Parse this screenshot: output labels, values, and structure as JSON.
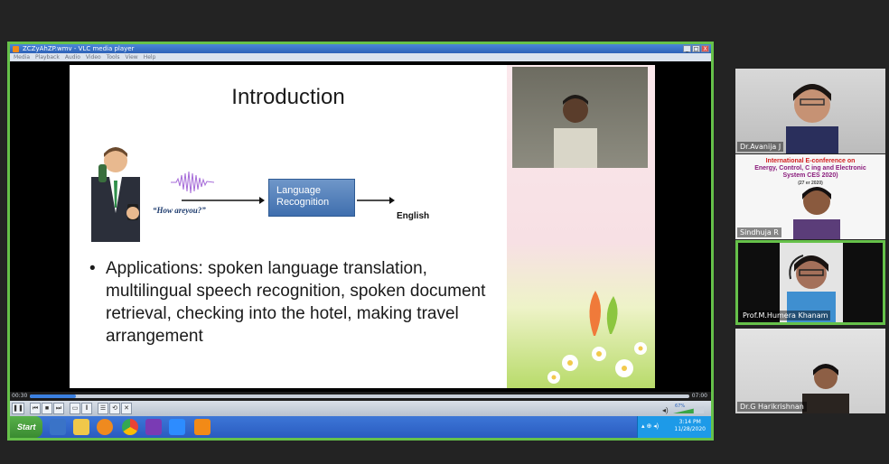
{
  "vlc": {
    "title": "ZCZyAhZP.wmv - VLC media player",
    "menu": [
      "Media",
      "Playback",
      "Audio",
      "Video",
      "Tools",
      "View",
      "Help"
    ],
    "window_controls": [
      "_",
      "□",
      "X"
    ],
    "elapsed": "00:30",
    "duration": "07:00",
    "progress": 0.07,
    "volume_label": "67%",
    "volume": 0.67
  },
  "slide": {
    "title": "Introduction",
    "quote": "“How areyou?”",
    "box_label": "Language Recognition",
    "output": "English",
    "bullet": "Applications:  spoken language translation, multilingual speech recognition, spoken document retrieval, checking into the hotel, making travel arrangement"
  },
  "taskbar": {
    "start_label": "Start",
    "time": "3:14 PM",
    "date": "11/28/2020"
  },
  "participants": [
    {
      "name": "Dr.Avanija J",
      "active": false
    },
    {
      "name": "Sindhuja R",
      "active": false
    },
    {
      "name": "Prof.M.Humera Khanam",
      "active": true
    },
    {
      "name": "Dr.G Harikrishnan",
      "active": false
    }
  ],
  "poster": {
    "line1": "International E-conference on",
    "line2": "Energy, Control, C",
    "line2b": "ing and Electronic",
    "line3": "System",
    "line3b": "CES 2020)",
    "line4": "(27",
    "line4b": "er 2020)"
  },
  "colors": {
    "share_border": "#66c14a",
    "seek_fill": "#3b80e0",
    "lang_box": "#4a7ab7"
  }
}
